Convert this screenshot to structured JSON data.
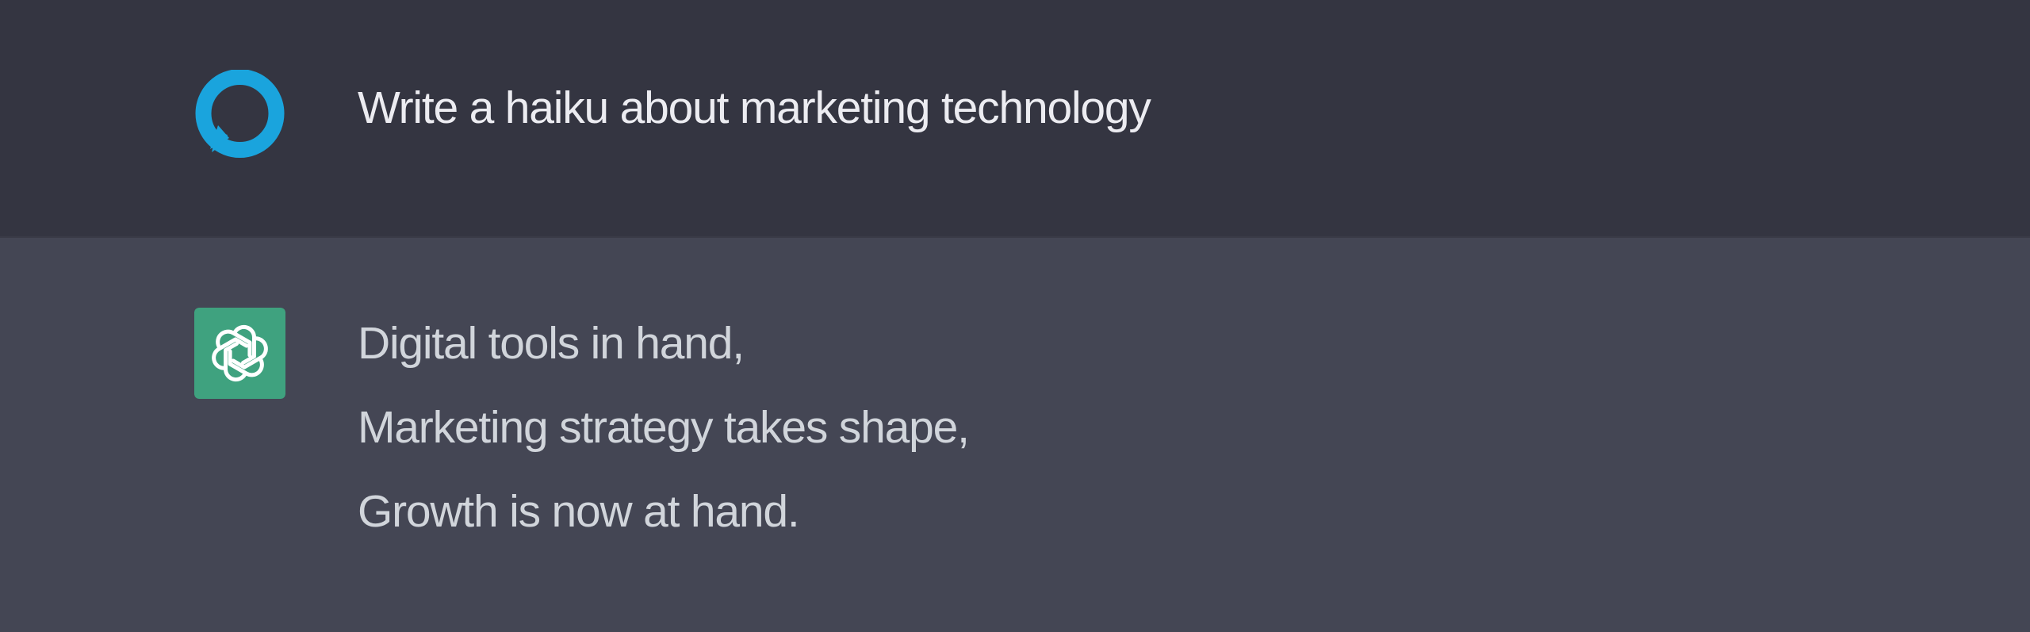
{
  "conversation": {
    "user_message": {
      "avatar_icon": "chat-bubble-icon",
      "avatar_color": "#1aa4dd",
      "text": "Write a haiku about marketing technology"
    },
    "assistant_message": {
      "avatar_icon": "openai-logo-icon",
      "avatar_color": "#3fa27f",
      "lines": [
        "Digital tools in hand,",
        "Marketing strategy takes shape,",
        "Growth is now at hand."
      ]
    }
  },
  "colors": {
    "user_row_bg": "#343541",
    "assistant_row_bg": "#444654",
    "text": "#ececf1"
  }
}
